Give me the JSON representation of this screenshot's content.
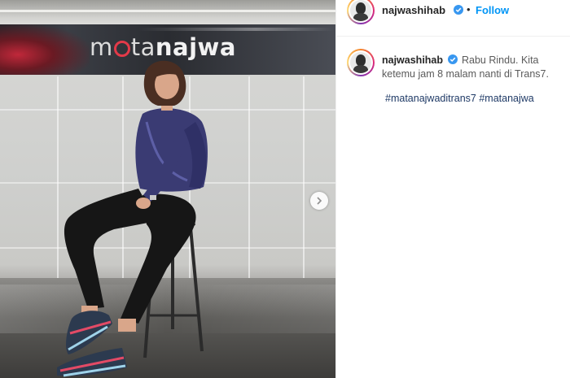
{
  "photo": {
    "studio_logo": {
      "prefix": "m",
      "middle": "ta",
      "suffix": "najwa"
    },
    "next_icon": "chevron-right-icon"
  },
  "header": {
    "username": "najwashihab",
    "verified_icon": "verified-badge-icon",
    "separator": "•",
    "follow_label": "Follow"
  },
  "post": {
    "username": "najwashihab",
    "caption_line_1": "Rabu Rindu. Kita",
    "caption_line_2": "ketemu jam 8 malam nanti di Trans7.",
    "hashtags": [
      "#matanajwaditrans7",
      "#matanajwa"
    ]
  },
  "colors": {
    "follow_blue": "#0095f6",
    "verified_blue": "#3897f0",
    "hashtag_blue": "#1f3a66",
    "logo_red": "#e33a49"
  }
}
